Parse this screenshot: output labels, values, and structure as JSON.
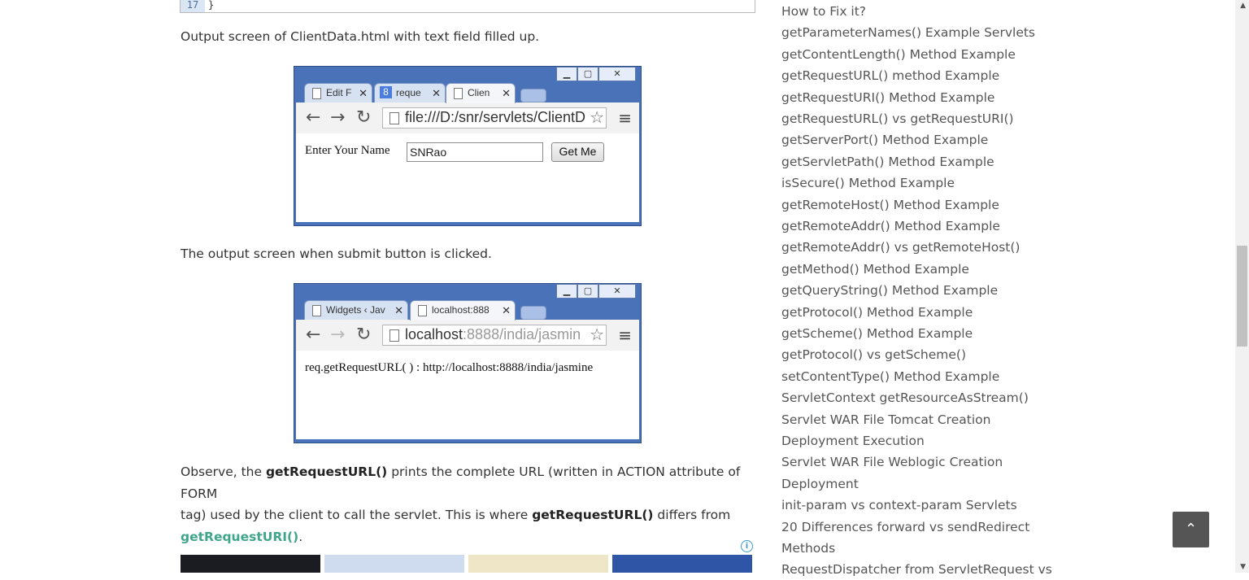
{
  "code_block": {
    "line_number": "17",
    "code": "}"
  },
  "paragraphs": {
    "p1": "Output screen of ClientData.html with text field filled up.",
    "p2": "The output screen when submit button is clicked.",
    "p3": {
      "t1": "Observe, the ",
      "b1": "getRequestURL()",
      "t2": " prints the complete URL (written in ACTION attribute of FORM",
      "t3": "tag) used by the client to call the servlet. This is where ",
      "b2": "getRequestURL()",
      "t4": " differs from",
      "link": "getRequestURI()",
      "t5": "."
    }
  },
  "screenshot1": {
    "tabs": [
      "Edit F",
      "reque",
      "Clien"
    ],
    "url": "file:///D:/snr/servlets/ClientD",
    "form_label": "Enter Your Name",
    "input_value": "SNRao",
    "button_label": "Get Me"
  },
  "screenshot2": {
    "tabs": [
      "Widgets ‹ Jav",
      "localhost:888"
    ],
    "url_host": "localhost",
    "url_rest": ":8888/india/jasmin",
    "result": "req.getRequestURL( ) : http://localhost:8888/india/jasmine"
  },
  "ad": {
    "info_icon": "i"
  },
  "sidebar": {
    "links": [
      "How to Fix it?",
      "getParameterNames() Example Servlets",
      "getContentLength() Method Example",
      "getRequestURL() method Example",
      "getRequestURI() Method Example",
      "getRequestURL() vs getRequestURI()",
      "getServerPort() Method Example",
      "getServletPath() Method Example",
      "isSecure() Method Example",
      "getRemoteHost() Method Example",
      "getRemoteAddr() Method Example",
      "getRemoteAddr() vs getRemoteHost()",
      "getMethod() Method Example",
      "getQueryString() Method Example",
      "getProtocol() Method Example",
      "getScheme() Method Example",
      "getProtocol() vs getScheme()",
      "setContentType() Method Example",
      "ServletContext getResourceAsStream()",
      "Servlet WAR File Tomcat Creation",
      "Deployment Execution",
      "Servlet WAR File Weblogic Creation",
      "Deployment",
      "init-param vs context-param Servlets",
      "20 Differences forward vs sendRedirect",
      "Methods",
      "RequestDispatcher from ServletRequest vs"
    ]
  },
  "back_to_top": {
    "icon": "chevron-up-icon",
    "glyph": "⌃"
  }
}
